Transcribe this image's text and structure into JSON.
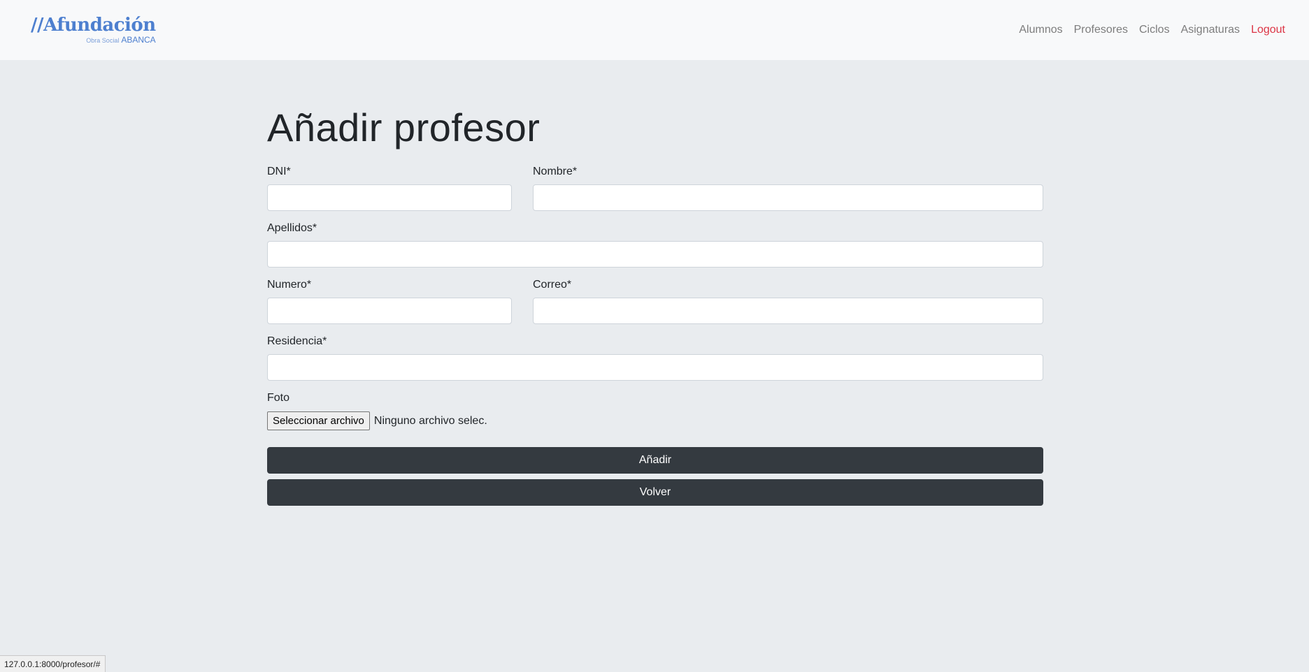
{
  "brand": {
    "name": "//Afundación",
    "sub_small": "Obra Social",
    "sub_main": "ABANCA"
  },
  "nav": {
    "items": [
      {
        "label": "Alumnos"
      },
      {
        "label": "Profesores"
      },
      {
        "label": "Ciclos"
      },
      {
        "label": "Asignaturas"
      }
    ],
    "logout": "Logout"
  },
  "page": {
    "title": "Añadir profesor"
  },
  "form": {
    "dni": {
      "label": "DNI*",
      "value": ""
    },
    "nombre": {
      "label": "Nombre*",
      "value": ""
    },
    "apellidos": {
      "label": "Apellidos*",
      "value": ""
    },
    "numero": {
      "label": "Numero*",
      "value": ""
    },
    "correo": {
      "label": "Correo*",
      "value": ""
    },
    "residencia": {
      "label": "Residencia*",
      "value": ""
    },
    "foto": {
      "label": "Foto",
      "button": "Seleccionar archivo",
      "status": "Ninguno archivo selec."
    },
    "submit": "Añadir",
    "back": "Volver"
  },
  "status_url": "127.0.0.1:8000/profesor/#",
  "colors": {
    "brand": "#4d7fcf",
    "logout": "#dc3545",
    "button": "#343a40"
  }
}
